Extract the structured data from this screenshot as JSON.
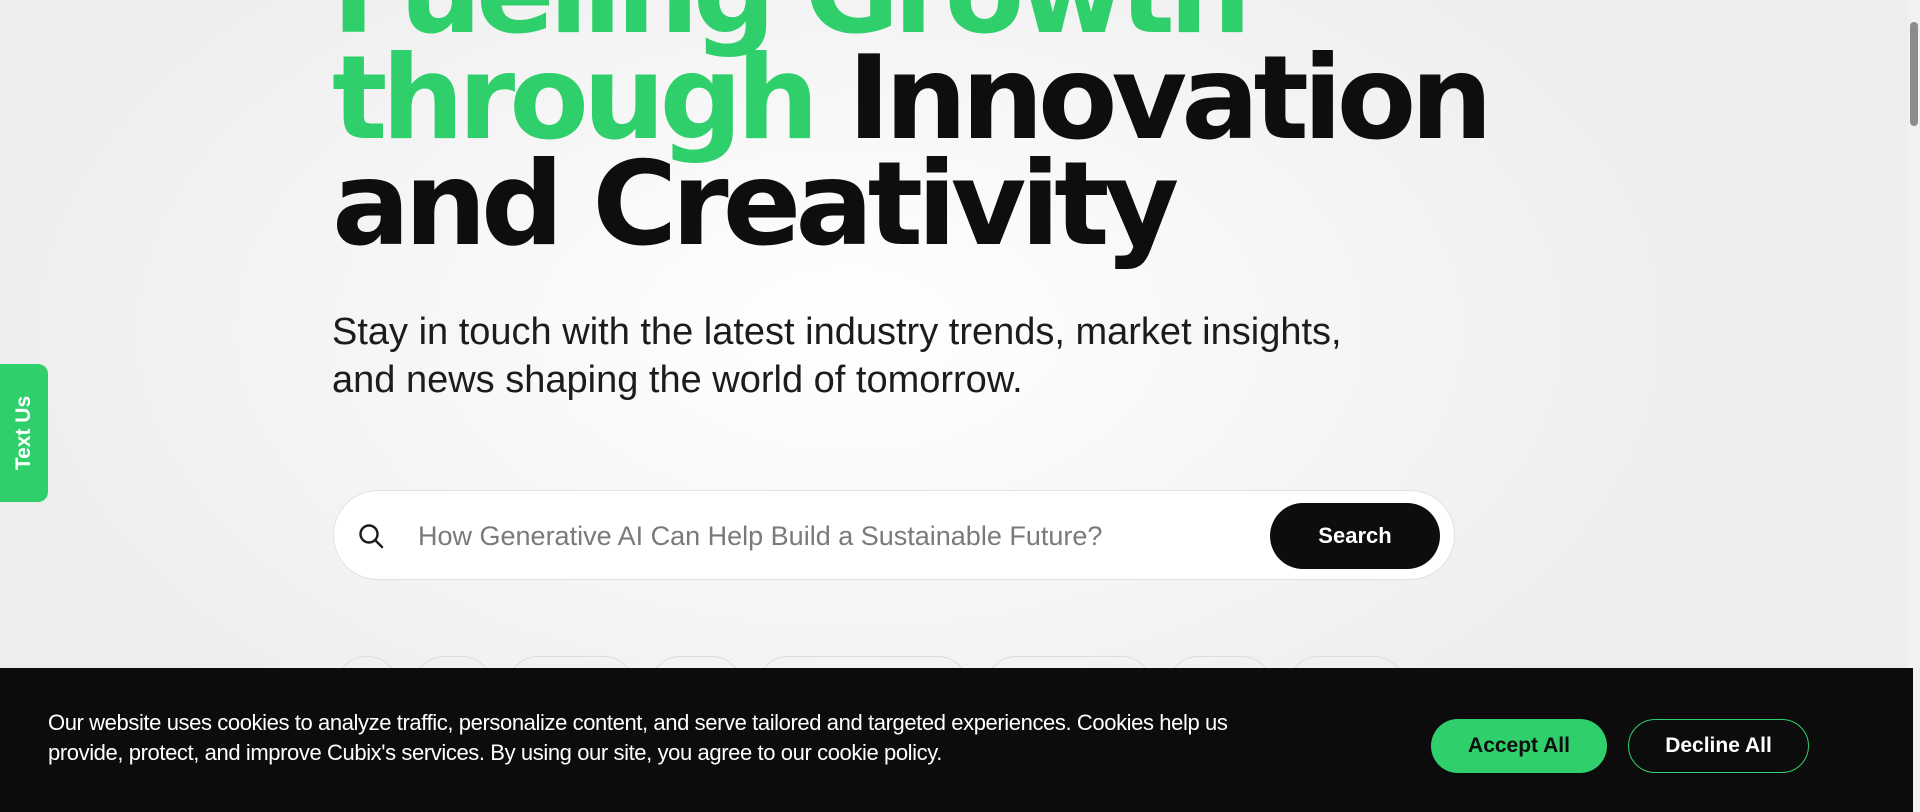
{
  "hero": {
    "headline_line1_green": "Fueling Growth",
    "headline_line2_green": "through",
    "headline_line2_dark": "Innovation",
    "headline_line3_dark": "and Creativity",
    "subtitle": "Stay in touch with the latest industry trends, market insights, and news shaping the world of tomorrow."
  },
  "search": {
    "placeholder": "How Generative AI Can Help Build a Sustainable Future?",
    "button_label": "Search",
    "icon": "search-icon"
  },
  "side_tab": {
    "label": "Text Us"
  },
  "cookie_banner": {
    "text": "Our website uses cookies to analyze traffic, personalize content, and serve tailored and targeted experiences. Cookies help us provide, protect, and improve Cubix's services. By using our site, you agree to our cookie policy.",
    "accept_label": "Accept All",
    "decline_label": "Decline All"
  },
  "colors": {
    "accent": "#2fd06b",
    "dark": "#0d0d0d",
    "background": "#f4f4f4"
  }
}
